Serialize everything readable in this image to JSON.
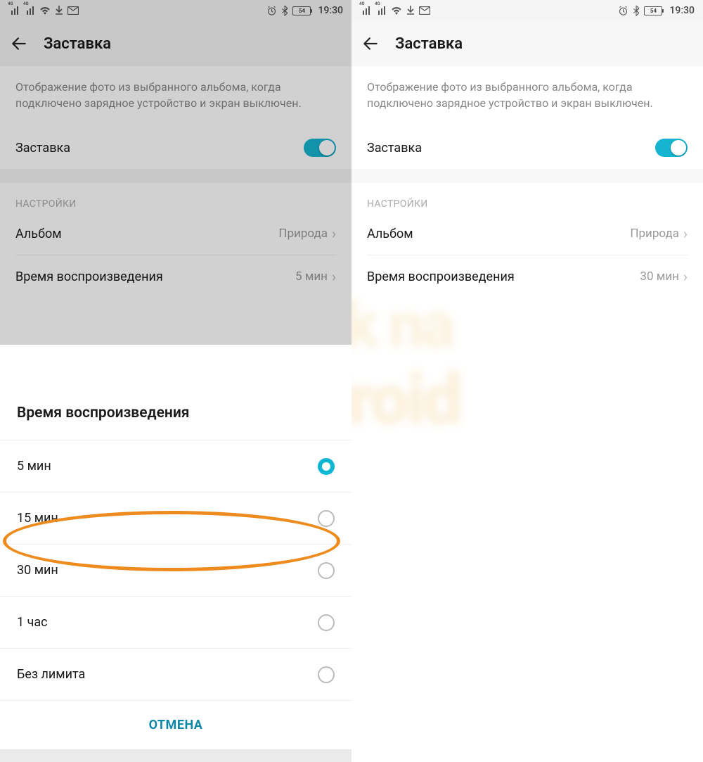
{
  "status": {
    "sig_label": "4G",
    "battery": "54",
    "time": "19:30"
  },
  "header": {
    "title": "Заставка"
  },
  "description": "Отображение фото из выбранного альбома, когда подключено зарядное устройство и экран выключен.",
  "toggle": {
    "label": "Заставка"
  },
  "section": "НАСТРОЙКИ",
  "album": {
    "label": "Альбом",
    "value": "Природа"
  },
  "playback": {
    "label": "Время воспроизведения"
  },
  "left": {
    "playback_value": "5 мин"
  },
  "right": {
    "playback_value": "30 мин"
  },
  "sheet": {
    "title": "Время воспроизведения",
    "options": [
      "5 мин",
      "15 мин",
      "30 мин",
      "1 час",
      "Без лимита"
    ],
    "cancel": "ОТМЕНА"
  },
  "colors": {
    "accent": "#0fb6d3",
    "highlight": "#ee8b1e"
  }
}
